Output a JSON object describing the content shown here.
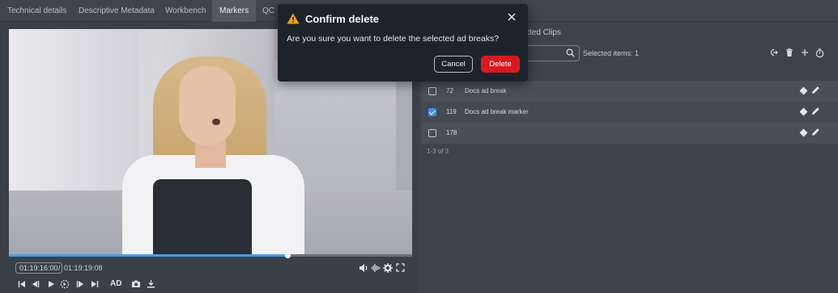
{
  "tabs": [
    {
      "label": "Technical details",
      "active": false
    },
    {
      "label": "Descriptive Metadata",
      "active": false
    },
    {
      "label": "Workbench",
      "active": false
    },
    {
      "label": "Markers",
      "active": true
    },
    {
      "label": "QC",
      "active": false
    }
  ],
  "player": {
    "current_time": "01:19:16:00",
    "separator": "/",
    "duration": "01:19:19:08",
    "progress_fraction": 0.69,
    "ad_label": "AD"
  },
  "markers_panel": {
    "tab_label_partial": "cted Clips",
    "selected_text": "Selected items: 1",
    "rows": [
      {
        "id": "72",
        "name": "Docs ad break",
        "checked": false
      },
      {
        "id": "119",
        "name": "Docs ad break marker",
        "checked": true
      },
      {
        "id": "178",
        "name": "",
        "checked": false
      }
    ],
    "pagination": "1-3 of 3"
  },
  "dialog": {
    "title": "Confirm delete",
    "message": "Are you sure you want to delete the selected ad breaks?",
    "cancel_label": "Cancel",
    "delete_label": "Delete"
  },
  "colors": {
    "accent": "#3f8de0",
    "danger": "#d51b21",
    "warning": "#f0a020",
    "dialog_bg": "#1d232b"
  },
  "icons": [
    "warning-icon",
    "close-icon",
    "search-icon",
    "export-icon",
    "trash-icon",
    "plus-icon",
    "timer-icon",
    "diamond-icon",
    "pencil-icon",
    "volume-icon",
    "waveform-icon",
    "gear-icon",
    "fullscreen-icon",
    "skip-start-icon",
    "frame-back-icon",
    "play-icon",
    "loop-icon",
    "frame-forward-icon",
    "skip-end-icon",
    "camera-icon",
    "download-icon"
  ]
}
